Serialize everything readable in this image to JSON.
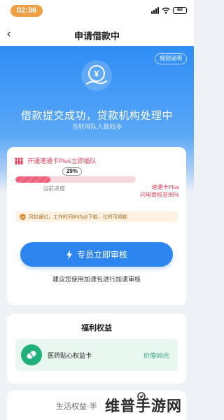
{
  "status_bar": {
    "time": "02:36",
    "battery": "60"
  },
  "nav": {
    "back_icon": "‹",
    "title": "申请借款中"
  },
  "hero": {
    "rules_label": "规则说明",
    "title": "借款提交成功，贷款机构处理中",
    "subtitle": "当前排队人数较多"
  },
  "express": {
    "headline": "开通速通卡Plus立即插队",
    "progress_percent": 29,
    "progress_badge": "29%",
    "progress_label": "当前进度",
    "note_line1": "速通卡Plus",
    "note_line2": "闪电审核至98%"
  },
  "risk_notice": "风控通过，工作时间8h内必下款，过时可退款",
  "review_button": "专员立即审核",
  "suggestion": "建议您使用加速包进行加速审核",
  "benefits": {
    "title": "福利权益",
    "item_name": "医药贴心权益卡",
    "item_price": "价值99元"
  },
  "life_benefits_title": "生活权益·半",
  "watermark": "维普手游网",
  "colors": {
    "primary": "#2d86ef",
    "accent_red": "#e53e5a",
    "benefit_green": "#1fa36f",
    "time_pill": "#f0a044"
  }
}
